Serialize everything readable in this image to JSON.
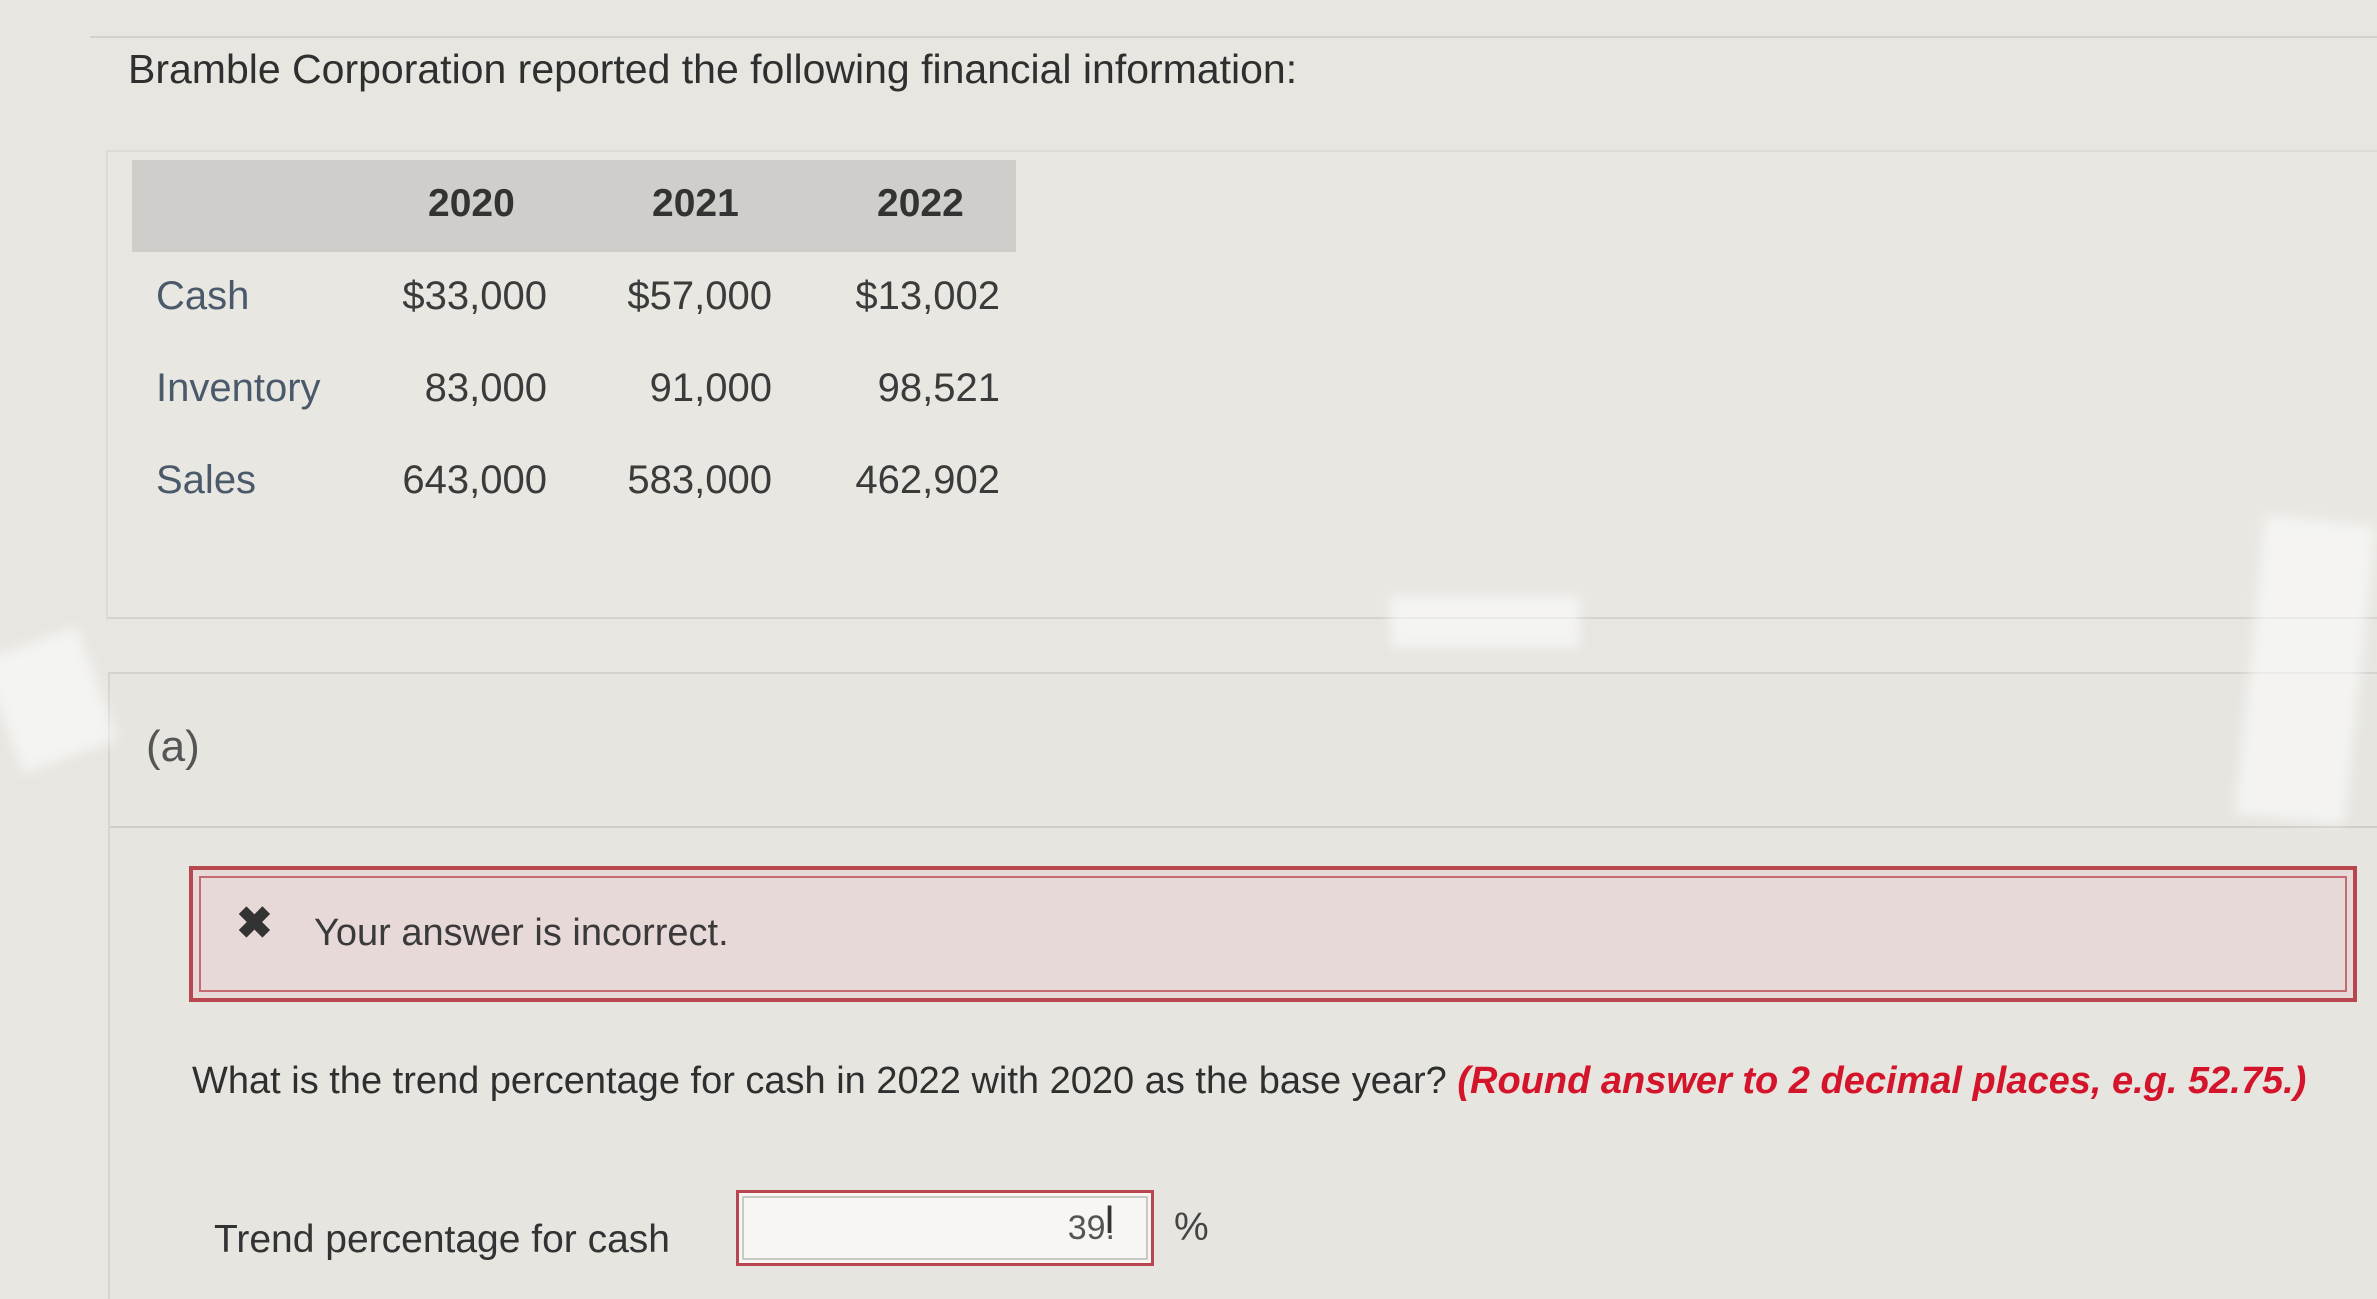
{
  "intro": {
    "text": "Bramble Corporation reported the following financial information:"
  },
  "table": {
    "years": [
      "2020",
      "2021",
      "2022"
    ],
    "rows": [
      {
        "label": "Cash",
        "values": [
          "$33,000",
          "$57,000",
          "$13,002"
        ]
      },
      {
        "label": "Inventory",
        "values": [
          "83,000",
          "91,000",
          "98,521"
        ]
      },
      {
        "label": "Sales",
        "values": [
          "643,000",
          "583,000",
          "462,902"
        ]
      }
    ]
  },
  "part": {
    "label": "(a)"
  },
  "feedback": {
    "text": "Your answer is incorrect.",
    "icon": "x-mark-icon"
  },
  "question": {
    "text": "What is the trend percentage for cash in 2022 with 2020 as the base year?",
    "hint": "(Round answer to 2 decimal places, e.g. 52.75.)"
  },
  "answer": {
    "label": "Trend percentage for cash",
    "value": "39.",
    "unit": "%"
  },
  "colors": {
    "error_border": "#b9454e",
    "hint_red": "#d4142a",
    "table_header_bg": "#cfceca"
  }
}
